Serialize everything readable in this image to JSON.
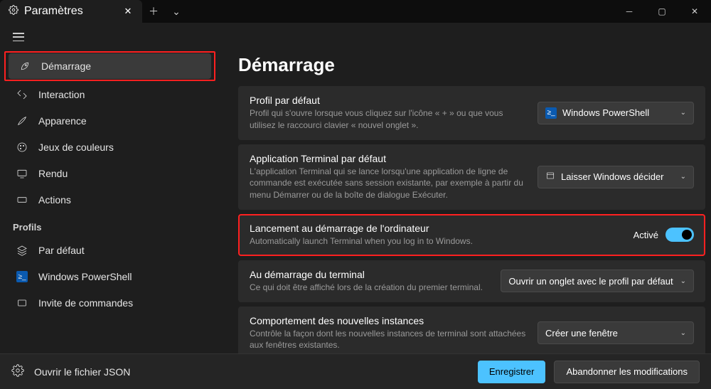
{
  "titlebar": {
    "tab_title": "Paramètres"
  },
  "sidebar": {
    "items": [
      {
        "label": "Démarrage"
      },
      {
        "label": "Interaction"
      },
      {
        "label": "Apparence"
      },
      {
        "label": "Jeux de couleurs"
      },
      {
        "label": "Rendu"
      },
      {
        "label": "Actions"
      }
    ],
    "profiles_label": "Profils",
    "profiles": [
      {
        "label": "Par défaut"
      },
      {
        "label": "Windows PowerShell"
      },
      {
        "label": "Invite de commandes"
      }
    ]
  },
  "content": {
    "heading": "Démarrage",
    "cards": {
      "default_profile": {
        "title": "Profil par défaut",
        "desc": "Profil qui s'ouvre lorsque vous cliquez sur l'icône « + » ou que vous utilisez le raccourci clavier « nouvel onglet ».",
        "value": "Windows PowerShell"
      },
      "default_terminal": {
        "title": "Application Terminal par défaut",
        "desc": "L'application Terminal qui se lance lorsqu'une application de ligne de commande est exécutée sans session existante, par exemple à partir du menu Démarrer ou de la boîte de dialogue Exécuter.",
        "value": "Laisser Windows décider"
      },
      "launch_on_startup": {
        "title": "Lancement au démarrage de l'ordinateur",
        "desc": "Automatically launch Terminal when you log in to Windows.",
        "state": "Activé"
      },
      "on_terminal_start": {
        "title": "Au démarrage du terminal",
        "desc": "Ce qui doit être affiché lors de la création du premier terminal.",
        "value": "Ouvrir un onglet avec le profil par défaut"
      },
      "new_instance": {
        "title": "Comportement des nouvelles instances",
        "desc": "Contrôle la façon dont les nouvelles instances de terminal sont attachées aux fenêtres existantes.",
        "value": "Créer une fenêtre"
      }
    }
  },
  "footer": {
    "open_json": "Ouvrir le fichier JSON",
    "save": "Enregistrer",
    "discard": "Abandonner les modifications"
  }
}
